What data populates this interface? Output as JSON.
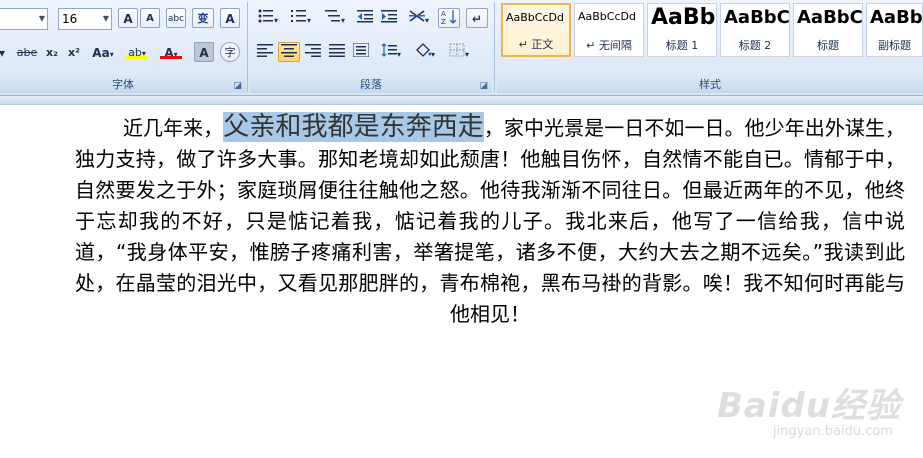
{
  "font_group": {
    "label": "字体",
    "font_size": "16",
    "grow_font": "A",
    "shrink_font": "A",
    "phonetic": "abc",
    "change_case_short": "变",
    "border_char": "A",
    "strike": "abe",
    "subscript": "x₂",
    "superscript": "x²",
    "case_menu": "Aa",
    "highlight": "ab",
    "font_color": "A",
    "shading": "A",
    "enclose": "字"
  },
  "paragraph_group": {
    "label": "段落"
  },
  "styles_group": {
    "label": "样式",
    "items": [
      {
        "sample": "AaBbCcDd",
        "name": "↵ 正文"
      },
      {
        "sample": "AaBbCcDd",
        "name": "↵ 无间隔"
      },
      {
        "sample": "AaBb",
        "name": "标题 1"
      },
      {
        "sample": "AaBbC",
        "name": "标题 2"
      },
      {
        "sample": "AaBbC",
        "name": "标题"
      },
      {
        "sample": "AaBbC",
        "name": "副标题"
      }
    ]
  },
  "document": {
    "lead": "近几年来，",
    "highlighted": "父亲和我都是东奔西走",
    "rest": "，家中光景是一日不如一日。他少年出外谋生，独力支持，做了许多大事。那知老境却如此颓唐！他触目伤怀，自然情不能自已。情郁于中，自然要发之于外；家庭琐屑便往往触他之怒。他待我渐渐不同往日。但最近两年的不见，他终于忘却我的不好，只是惦记着我，惦记着我的儿子。我北来后，他写了一信给我，信中说道，“我身体平安，惟膀子疼痛利害，举箸提笔，诸多不便，大约大去之期不远矣。”我读到此处，在晶莹的泪光中，又看见那肥胖的，青布棉袍，黑布马褂的背影。唉！我不知何时再能与他相见！"
  },
  "watermark": {
    "logo": "Baidu经验",
    "url": "jingyan.baidu.com"
  },
  "colors": {
    "highlight": "#a8c8e8",
    "font_color_bar": "#e01010",
    "highlight_bar": "#ffff00",
    "selected_style": "#f3b24b"
  }
}
